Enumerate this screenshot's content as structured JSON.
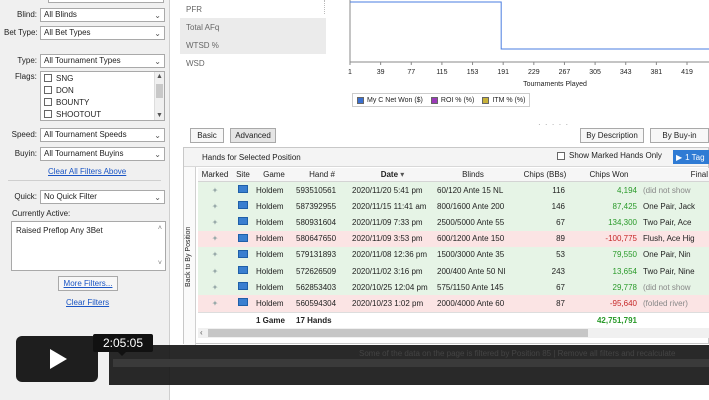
{
  "filters": {
    "blind_label": "Blind:",
    "blind_value": "All Blinds",
    "bet_type_label": "Bet Type:",
    "bet_type_value": "All Bet Types",
    "type_label": "Type:",
    "type_value": "All Tournament Types",
    "flags_label": "Flags:",
    "flags": [
      "SNG",
      "DON",
      "BOUNTY",
      "SHOOTOUT"
    ],
    "speed_label": "Speed:",
    "speed_value": "All Tournament Speeds",
    "buyin_label": "Buyin:",
    "buyin_value": "All Tournament Buyins",
    "clear_all_above": "Clear All Filters Above",
    "quick_label": "Quick:",
    "quick_value": "No Quick Filter",
    "currently_active_label": "Currently Active:",
    "currently_active_value": "Raised Preflop Any 3Bet",
    "more_filters": "More Filters...",
    "clear_filters": "Clear Filters"
  },
  "stats": [
    "PFR",
    "Total AFq",
    "WTSD %",
    "WSD"
  ],
  "chart_data": {
    "type": "line",
    "xlabel": "Tournaments Played",
    "x_ticks": [
      1,
      39,
      77,
      115,
      153,
      191,
      229,
      267,
      305,
      343,
      381,
      419
    ],
    "legend": [
      {
        "name": "My C Net Won ($)",
        "color": "#3a6fd0"
      },
      {
        "name": "ROI % (%)",
        "color": "#9b3ab8"
      },
      {
        "name": "ITM % (%)",
        "color": "#c8b23a"
      }
    ],
    "grid": false
  },
  "tabs": {
    "basic": "Basic",
    "advanced": "Advanced",
    "by_description": "By Description",
    "by_buyin": "By Buy-in"
  },
  "hands": {
    "title": "Hands for Selected Position",
    "show_marked": "Show Marked Hands Only",
    "tag_button": "1 Tag",
    "side_tab": "Back to By Position",
    "columns": [
      "Marked",
      "Site",
      "Game",
      "Hand #",
      "Date",
      "Blinds",
      "Chips (BBs)",
      "Chips Won",
      "Final"
    ],
    "rows": [
      {
        "game": "Holdem",
        "hand": "593510561",
        "date": "2020/11/20  5:41 pm",
        "blinds": "60/120 Ante 15 NL",
        "chips": "116",
        "won": "4,194",
        "final": "(did not show",
        "tone": "g"
      },
      {
        "game": "Holdem",
        "hand": "587392955",
        "date": "2020/11/15 11:41 am",
        "blinds": "800/1600 Ante 200",
        "chips": "146",
        "won": "87,425",
        "final": "One Pair, Jack",
        "tone": "g"
      },
      {
        "game": "Holdem",
        "hand": "580931604",
        "date": "2020/11/09  7:33 pm",
        "blinds": "2500/5000 Ante 55",
        "chips": "67",
        "won": "134,300",
        "final": "Two Pair, Ace",
        "tone": "g"
      },
      {
        "game": "Holdem",
        "hand": "580647650",
        "date": "2020/11/09  3:53 pm",
        "blinds": "600/1200 Ante 150",
        "chips": "89",
        "won": "-100,775",
        "final": "Flush, Ace Hig",
        "tone": "r"
      },
      {
        "game": "Holdem",
        "hand": "579131893",
        "date": "2020/11/08 12:36 pm",
        "blinds": "1500/3000 Ante 35",
        "chips": "53",
        "won": "79,550",
        "final": "One Pair, Nin",
        "tone": "g"
      },
      {
        "game": "Holdem",
        "hand": "572626509",
        "date": "2020/11/02  3:16 pm",
        "blinds": "200/400 Ante 50 NI",
        "chips": "243",
        "won": "13,654",
        "final": "Two Pair, Nine",
        "tone": "g"
      },
      {
        "game": "Holdem",
        "hand": "562853403",
        "date": "2020/10/25 12:04 pm",
        "blinds": "575/1150 Ante 145",
        "chips": "67",
        "won": "29,778",
        "final": "(did not show",
        "tone": "g"
      },
      {
        "game": "Holdem",
        "hand": "560594304",
        "date": "2020/10/23  1:02 pm",
        "blinds": "2000/4000 Ante 60",
        "chips": "87",
        "won": "-95,640",
        "final": "(folded river)",
        "tone": "r"
      }
    ],
    "totals": {
      "games": "1 Game",
      "hands": "17 Hands",
      "won": "42,751,791"
    }
  },
  "video": {
    "timestamp": "2:05:05",
    "faint_caption": "Some of the data on the page is filtered by Position 85 | Remove all filters and recalculate"
  }
}
